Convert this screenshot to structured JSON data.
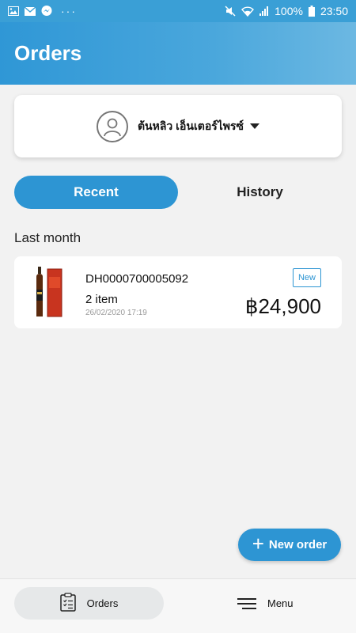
{
  "status_bar": {
    "icons_left": [
      "gallery-icon",
      "mail-icon",
      "messenger-icon"
    ],
    "more": "···",
    "battery": "100%",
    "time": "23:50",
    "icons_right": [
      "mute-icon",
      "wifi-icon",
      "signal-icon",
      "battery-icon"
    ]
  },
  "header": {
    "title": "Orders"
  },
  "store": {
    "name": "ต้นหลิว เอ็นเตอร์ไพรซ์"
  },
  "tabs": [
    {
      "label": "Recent",
      "active": true
    },
    {
      "label": "History",
      "active": false
    }
  ],
  "section": {
    "title": "Last month"
  },
  "orders": [
    {
      "id": "DH0000700005092",
      "items": "2 item",
      "date": "26/02/2020 17:19",
      "badge": "New",
      "price": "฿24,900"
    }
  ],
  "fab": {
    "label": "New order"
  },
  "bottom_nav": {
    "orders_label": "Orders",
    "menu_label": "Menu"
  },
  "colors": {
    "accent": "#2d95d3",
    "header_start": "#2f97d6",
    "header_end": "#6cb8e2",
    "background": "#f2f2f2"
  }
}
